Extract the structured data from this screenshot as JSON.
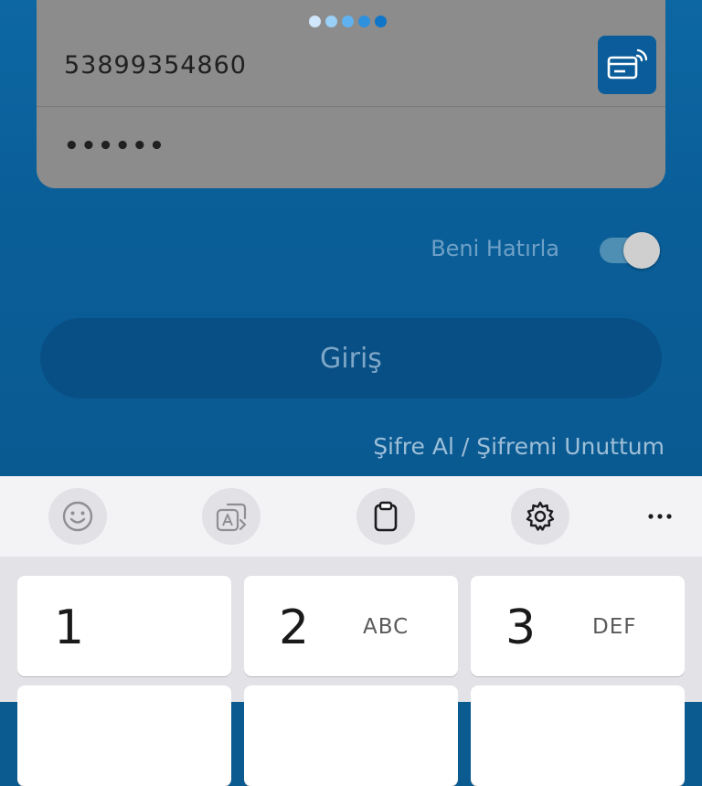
{
  "loading_dots": {
    "colors": [
      "#cfe6fb",
      "#9ad0f6",
      "#5fb2ef",
      "#2e91de",
      "#0e75c8"
    ]
  },
  "login_form": {
    "phone_value": "53899354860",
    "password_value": "••••••",
    "card_button_icon": "card-reader-icon"
  },
  "remember_me": {
    "label": "Beni Hatırla",
    "enabled": true
  },
  "login_button": {
    "label": "Giriş"
  },
  "forgot_link": {
    "label": "Şifre Al / Şifremi Unuttum"
  },
  "keyboard": {
    "toolbar": [
      {
        "icon": "emoji-icon"
      },
      {
        "icon": "translate-icon"
      },
      {
        "icon": "clipboard-icon"
      },
      {
        "icon": "settings-icon"
      },
      {
        "icon": "more-icon"
      }
    ],
    "keys": [
      {
        "num": "1",
        "letters": ""
      },
      {
        "num": "2",
        "letters": "ABC"
      },
      {
        "num": "3",
        "letters": "DEF"
      }
    ]
  },
  "colors": {
    "app_background": "#0b5f99",
    "field_background": "#8c8c8c",
    "button_background": "#084f85",
    "accent": "#0a5d9a"
  }
}
